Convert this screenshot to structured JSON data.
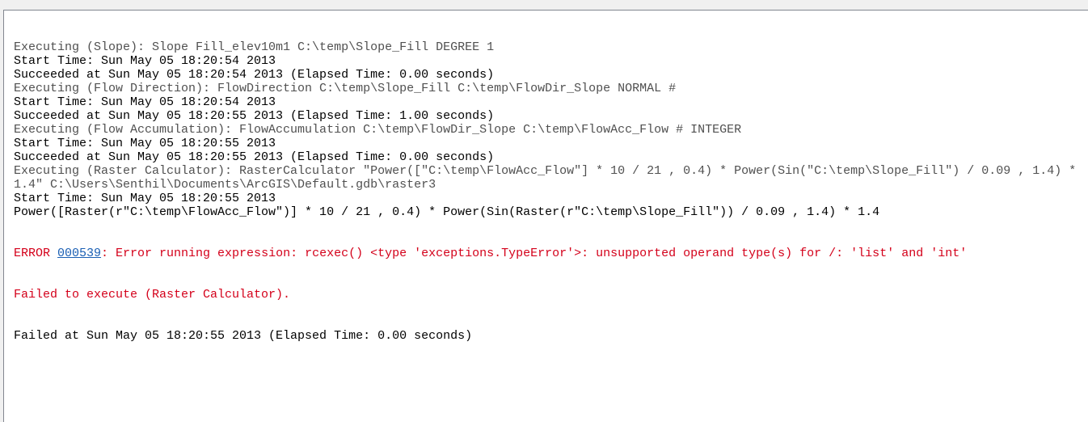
{
  "log": {
    "colors": {
      "info": "#505050",
      "normal": "#000000",
      "error": "#d4001a",
      "link": "#1a5fb4"
    },
    "lines": [
      {
        "type": "info",
        "text": "Executing (Slope): Slope Fill_elev10m1 C:\\temp\\Slope_Fill DEGREE 1"
      },
      {
        "type": "normal",
        "text": "Start Time: Sun May 05 18:20:54 2013"
      },
      {
        "type": "normal",
        "text": "Succeeded at Sun May 05 18:20:54 2013 (Elapsed Time: 0.00 seconds)"
      },
      {
        "type": "info",
        "text": "Executing (Flow Direction): FlowDirection C:\\temp\\Slope_Fill C:\\temp\\FlowDir_Slope NORMAL #"
      },
      {
        "type": "normal",
        "text": "Start Time: Sun May 05 18:20:54 2013"
      },
      {
        "type": "normal",
        "text": "Succeeded at Sun May 05 18:20:55 2013 (Elapsed Time: 1.00 seconds)"
      },
      {
        "type": "info",
        "text": "Executing (Flow Accumulation): FlowAccumulation C:\\temp\\FlowDir_Slope C:\\temp\\FlowAcc_Flow # INTEGER"
      },
      {
        "type": "normal",
        "text": "Start Time: Sun May 05 18:20:55 2013"
      },
      {
        "type": "normal",
        "text": "Succeeded at Sun May 05 18:20:55 2013 (Elapsed Time: 0.00 seconds)"
      },
      {
        "type": "info",
        "text": "Executing (Raster Calculator): RasterCalculator \"Power([\"C:\\temp\\FlowAcc_Flow\"] * 10 / 21 , 0.4) * Power(Sin(\"C:\\temp\\Slope_Fill\") / 0.09 , 1.4) *"
      },
      {
        "type": "info",
        "text": "1.4\" C:\\Users\\Senthil\\Documents\\ArcGIS\\Default.gdb\\raster3"
      },
      {
        "type": "normal",
        "text": "Start Time: Sun May 05 18:20:55 2013"
      },
      {
        "type": "normal",
        "text": "Power([Raster(r\"C:\\temp\\FlowAcc_Flow\")] * 10 / 21 , 0.4) * Power(Sin(Raster(r\"C:\\temp\\Slope_Fill\")) / 0.09 , 1.4) * 1.4"
      }
    ],
    "error": {
      "prefix": "ERROR ",
      "code": "000539",
      "message": ": Error running expression: rcexec() <type 'exceptions.TypeError'>: unsupported operand type(s) for /: 'list' and 'int'"
    },
    "failed_line": "Failed to execute (Raster Calculator).",
    "final_line": "Failed at Sun May 05 18:20:55 2013 (Elapsed Time: 0.00 seconds)"
  }
}
